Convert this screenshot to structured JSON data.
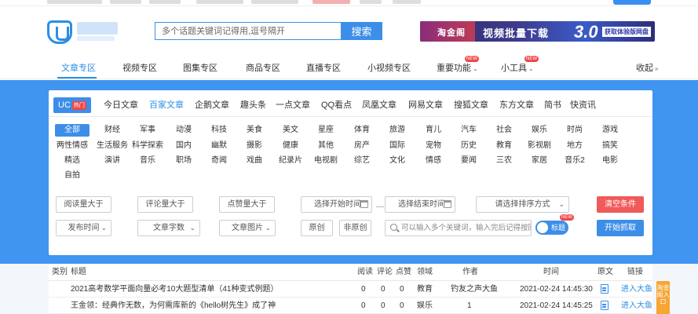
{
  "header": {
    "search_placeholder": "多个话题关键词记得用,逗号隔开",
    "search_button": "搜索",
    "banner": {
      "title": "淘金阁",
      "text": "视频批量下载",
      "number": "3.0",
      "cta": "获取体验版网盘"
    }
  },
  "nav": {
    "items": [
      {
        "label": "文章专区",
        "active": true
      },
      {
        "label": "视频专区"
      },
      {
        "label": "图集专区"
      },
      {
        "label": "商品专区"
      },
      {
        "label": "直播专区"
      },
      {
        "label": "小视频专区"
      },
      {
        "label": "重要功能",
        "badge": "NEW",
        "dropdown": true
      },
      {
        "label": "小工具",
        "badge": "NEW",
        "dropdown": true
      }
    ],
    "collapse": "收起",
    "collapse_icon": "double-chevron-down"
  },
  "sources": {
    "items": [
      "UC",
      "今日文章",
      "百家文章",
      "企鹅文章",
      "趣头条",
      "一点文章",
      "QQ看点",
      "凤凰文章",
      "网易文章",
      "搜狐文章",
      "东方文章",
      "简书",
      "快资讯"
    ],
    "selected": "UC",
    "hot_tag": "热门",
    "highlighted": "百家文章"
  },
  "categories": {
    "row1": [
      "全部",
      "财经",
      "军事",
      "动漫",
      "科技",
      "美食",
      "美文",
      "星座",
      "体育",
      "旅游",
      "育儿",
      "汽车",
      "社会",
      "娱乐",
      "时尚",
      "游戏"
    ],
    "row2": [
      "两性情感",
      "生活服务",
      "科学探索",
      "国内",
      "幽默",
      "摄影",
      "健康",
      "其他",
      "房产",
      "国际",
      "宠物",
      "历史",
      "教育",
      "影视剧",
      "地方",
      "搞笑"
    ],
    "row3": [
      "精选",
      "演讲",
      "音乐",
      "职场",
      "奇闻",
      "戏曲",
      "纪录片",
      "电视剧",
      "综艺",
      "文化",
      "情感",
      "要闻",
      "三农",
      "家居",
      "音乐2",
      "电影"
    ],
    "row4": [
      "自拍"
    ],
    "selected": "全部"
  },
  "filters": {
    "read_gt": "阅读量大于",
    "comment_gt": "评论量大于",
    "like_gt": "点赞量大于",
    "start_time": "选择开始时间",
    "end_time": "选择结束时间",
    "range_sep": "—",
    "sort": "请选择排序方式",
    "clear": "清空条件",
    "pub_time": "发布时间",
    "word_count": "文章字数",
    "images": "文章图片",
    "original": "原创",
    "non_original": "非原创",
    "keyword_placeholder": "可以输入多个关键词，输入完后记得按回车",
    "toggle_label": "标题",
    "toggle_badge": "NEW",
    "start": "开始抓取"
  },
  "table": {
    "headers": [
      "类别",
      "标题",
      "阅读",
      "评论",
      "点赞",
      "领域",
      "作者",
      "时间",
      "原文",
      "链接"
    ],
    "rows": [
      {
        "title": "2021高考数学平面向量必考10大题型清单（41种变式例题）",
        "read": "0",
        "comment": "0",
        "like": "0",
        "field": "教育",
        "author": "钓友之声大鱼",
        "time": "2021-02-24 14:45:30",
        "link": "进入大鱼"
      },
      {
        "title": "王金领：经典作无数，为何需库新的《hello树先生》成了神",
        "read": "0",
        "comment": "0",
        "like": "0",
        "field": "娱乐",
        "author": "1",
        "time": "2021-02-24 14:45:25",
        "link": "进入大鱼"
      }
    ]
  },
  "side_float": "淘金阁入口",
  "colors": {
    "accent": "#3d8ee8",
    "band": "#3f95ef",
    "danger": "#f05a5a"
  }
}
